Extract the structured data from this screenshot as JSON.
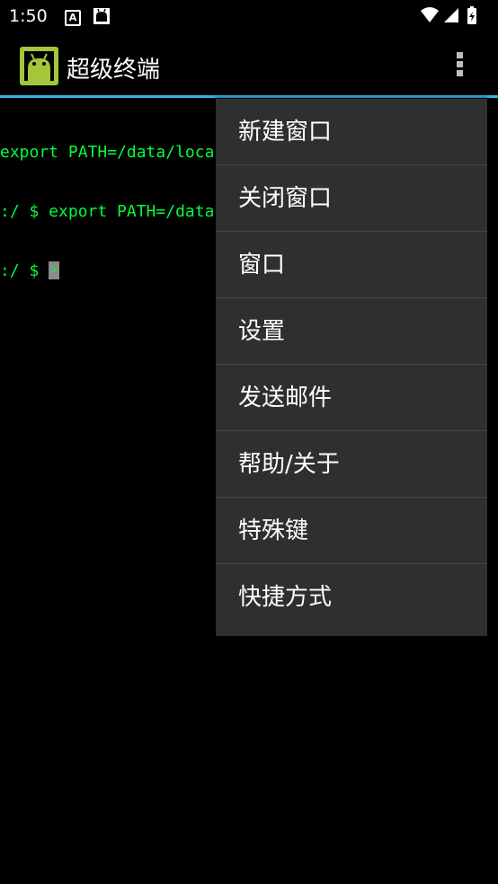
{
  "status_bar": {
    "time": "1:50",
    "notification_a": "A"
  },
  "action_bar": {
    "title": "超级终端",
    "app_icon": "android-app-icon",
    "overflow_icon": "more-vert-icon"
  },
  "terminal": {
    "lines": [
      "export PATH=/data/loca",
      ":/ $ export PATH=/data",
      ":/ $ "
    ],
    "cursor_char": ">"
  },
  "menu": {
    "items": [
      "新建窗口",
      "关闭窗口",
      "窗口",
      "设置",
      "发送邮件",
      "帮助/关于",
      "特殊键",
      "快捷方式"
    ]
  },
  "colors": {
    "accent": "#33b5e5",
    "terminal_text": "#00ff3c",
    "menu_bg": "#2f2f2f",
    "app_icon": "#a4c639"
  }
}
